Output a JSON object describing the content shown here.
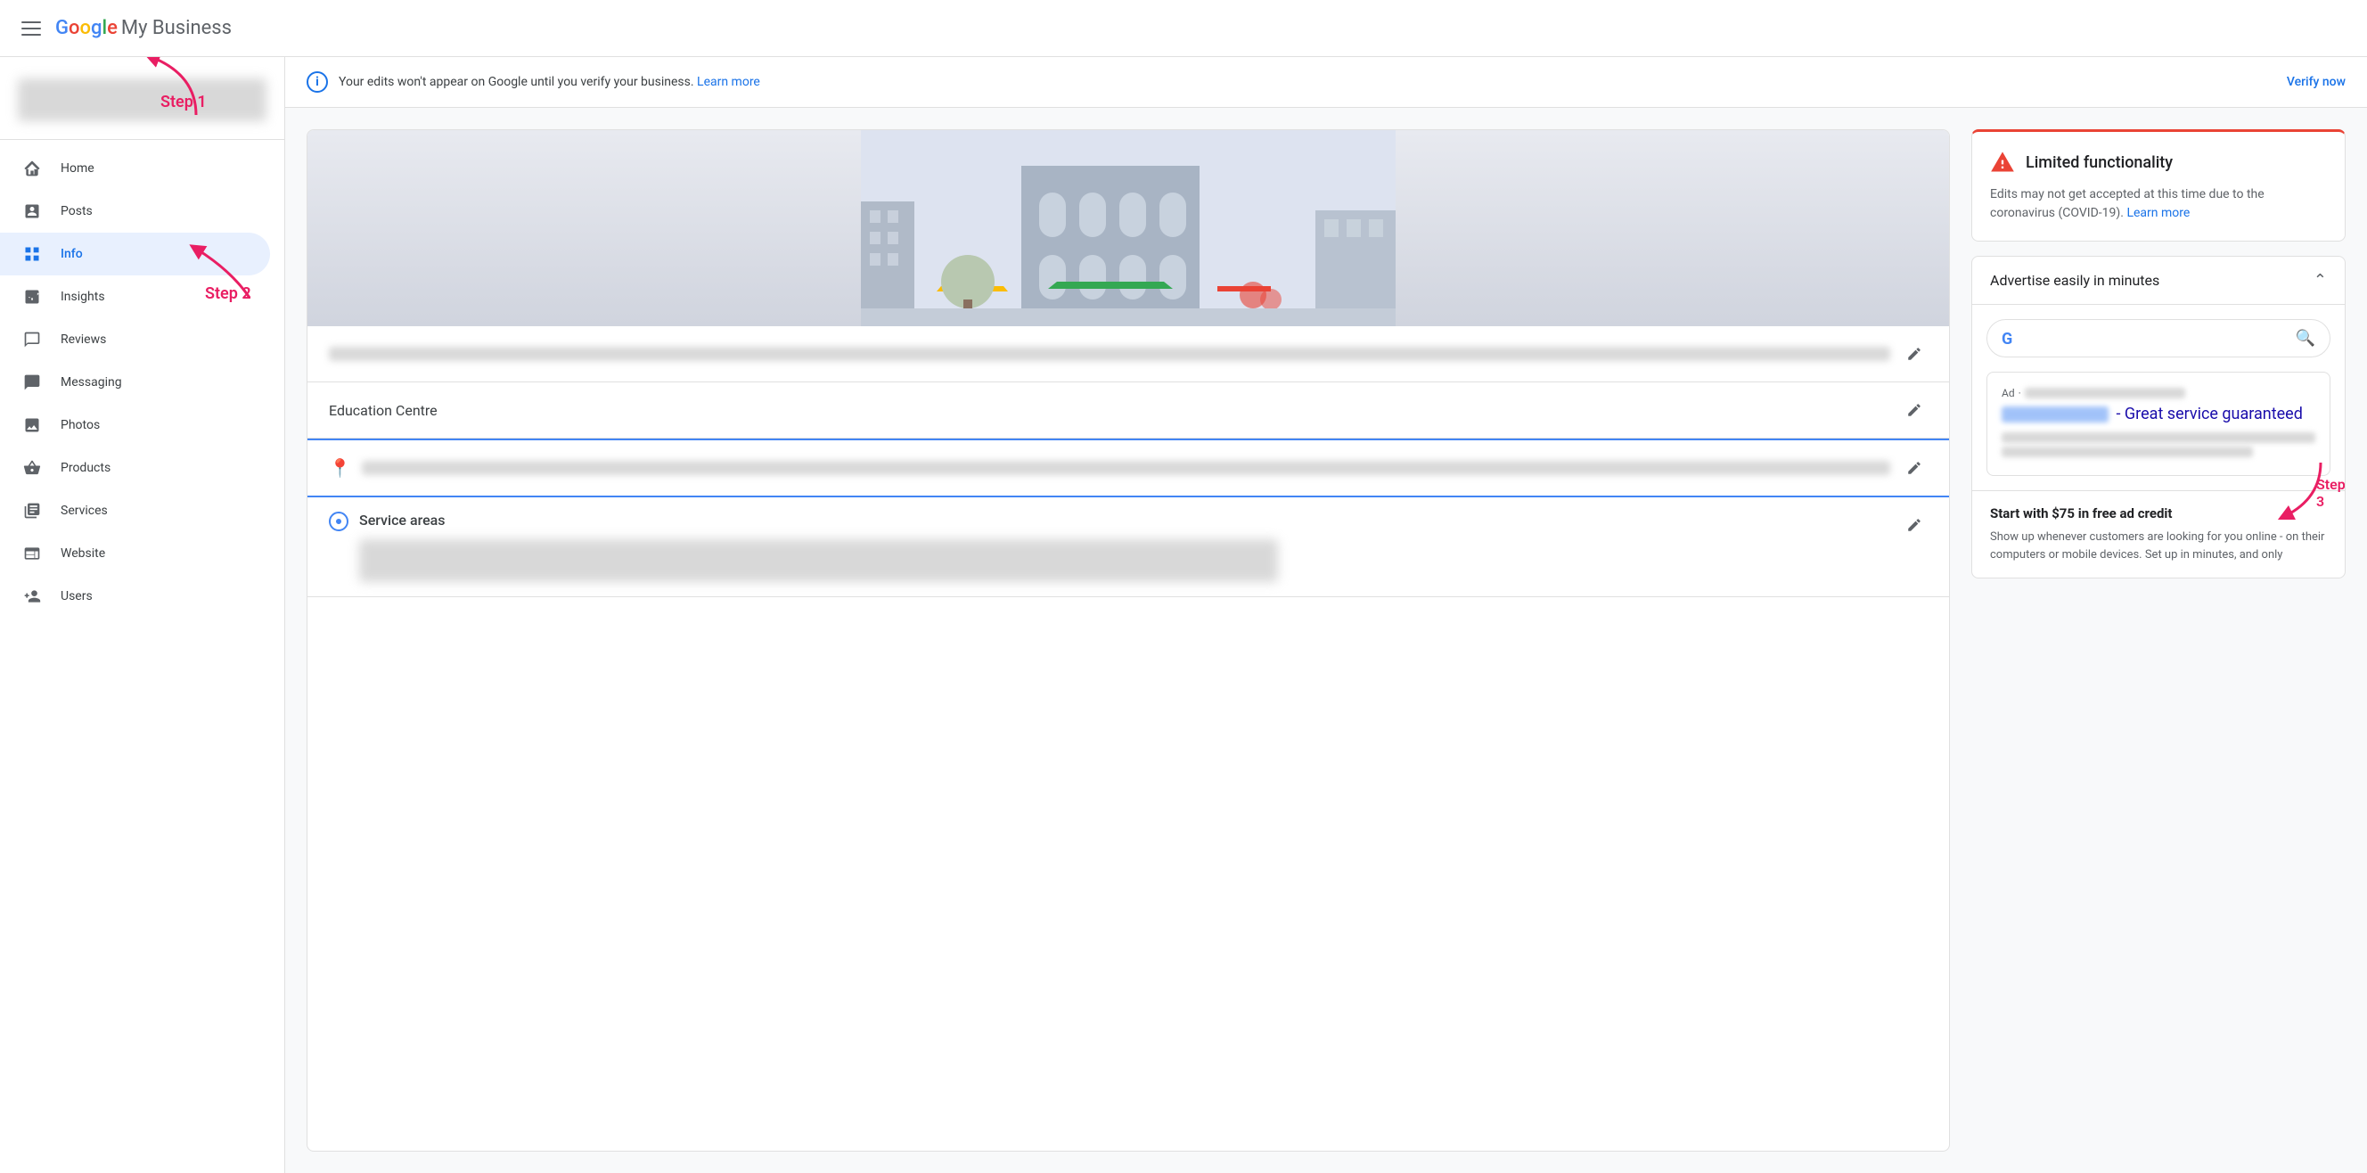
{
  "header": {
    "menu_label": "Menu",
    "logo_google": "Google",
    "logo_my_business": " My Business"
  },
  "sidebar": {
    "profile_blurred": true,
    "items": [
      {
        "id": "home",
        "label": "Home",
        "active": false
      },
      {
        "id": "posts",
        "label": "Posts",
        "active": false
      },
      {
        "id": "info",
        "label": "Info",
        "active": true
      },
      {
        "id": "insights",
        "label": "Insights",
        "active": false
      },
      {
        "id": "reviews",
        "label": "Reviews",
        "active": false
      },
      {
        "id": "messaging",
        "label": "Messaging",
        "active": false
      },
      {
        "id": "photos",
        "label": "Photos",
        "active": false
      },
      {
        "id": "products",
        "label": "Products",
        "active": false
      },
      {
        "id": "services",
        "label": "Services",
        "active": false
      },
      {
        "id": "website",
        "label": "Website",
        "active": false
      },
      {
        "id": "users",
        "label": "Users",
        "active": false
      }
    ]
  },
  "verify_banner": {
    "message": "Your edits won't appear on Google until you verify your business.",
    "learn_more": "Learn more",
    "verify_now": "Verify now"
  },
  "info_panel": {
    "business_name": "Education Centre",
    "location_blurred": true,
    "service_area_label": "Service areas"
  },
  "limited_functionality": {
    "title": "Limited functionality",
    "message": "Edits may not get accepted at this time due to the coronavirus (COVID-19).",
    "learn_more": "Learn more"
  },
  "advertise": {
    "title": "Advertise easily in minutes",
    "expanded": true,
    "ad": {
      "label": "Ad",
      "title_suffix": "- Great service guaranteed"
    },
    "free_credit": {
      "title": "Start with $75 in free ad credit",
      "text": "Show up whenever customers are looking for you online - on their computers or mobile devices. Set up in minutes, and only"
    }
  },
  "steps": {
    "step1": "Step 1",
    "step2": "Step 2",
    "step3": "Step 3"
  }
}
